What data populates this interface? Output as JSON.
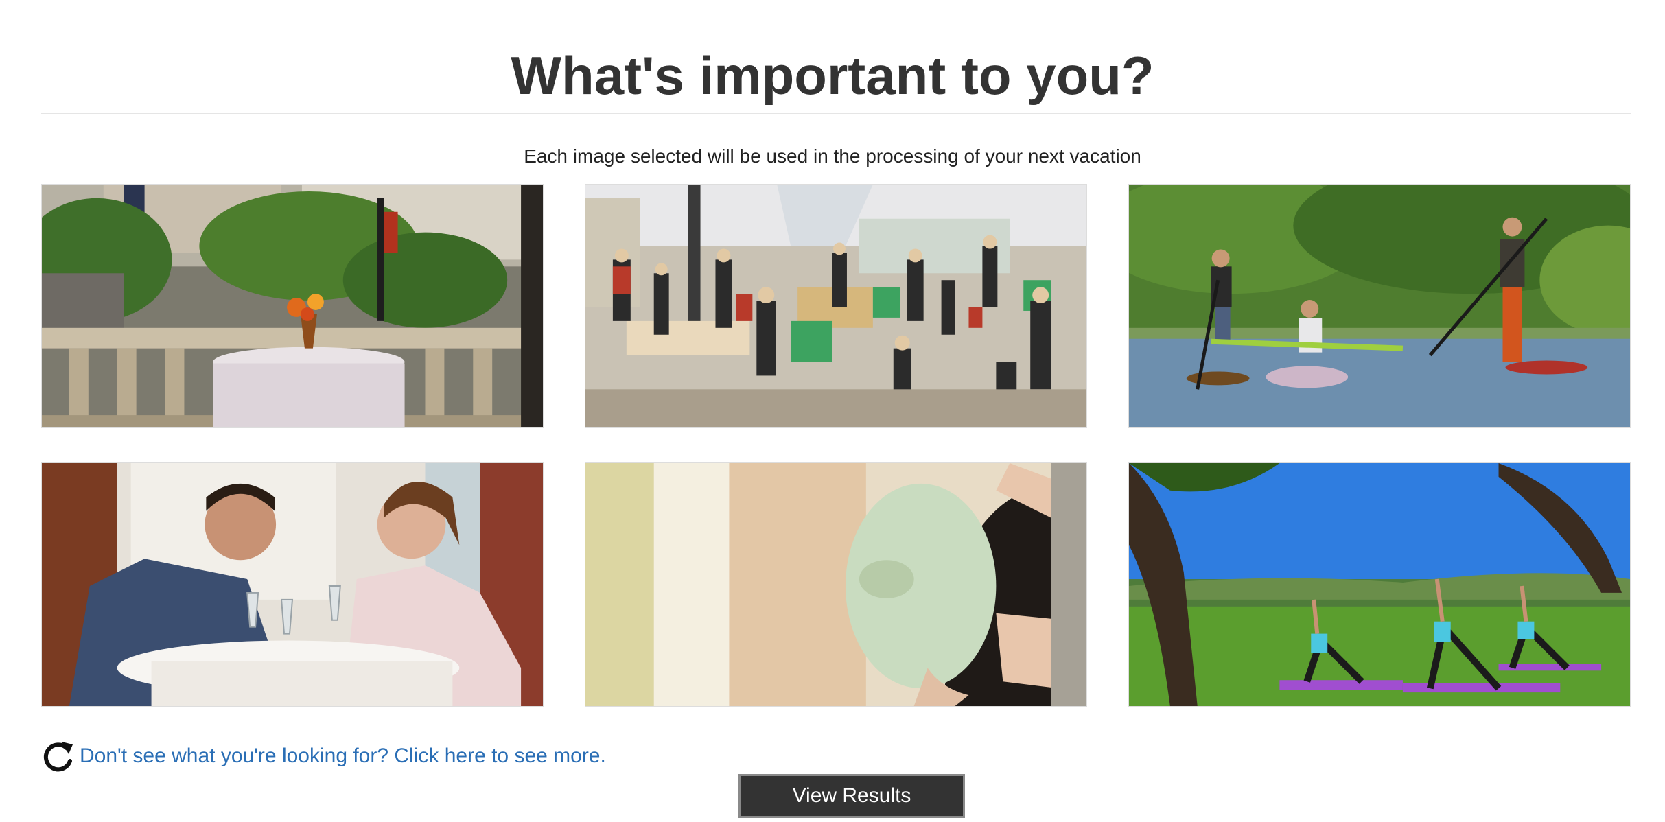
{
  "header": {
    "title": "What's important to you?",
    "subtitle": "Each image selected will be used in the processing of your next vacation"
  },
  "images": [
    {
      "name": "rooftop-dining-image",
      "icon": "photo-rooftop-table"
    },
    {
      "name": "childrens-museum-image",
      "icon": "photo-crowded-museum"
    },
    {
      "name": "paddleboard-kayak-image",
      "icon": "photo-paddle-river"
    },
    {
      "name": "romantic-dinner-image",
      "icon": "photo-couple-dinner"
    },
    {
      "name": "spa-facial-image",
      "icon": "photo-face-mask"
    },
    {
      "name": "outdoor-yoga-image",
      "icon": "photo-yoga-park"
    }
  ],
  "footer": {
    "more_icon": "refresh-icon",
    "more_link": "Don't see what you're looking for? Click here to see more.",
    "button_label": "View Results"
  },
  "colors": {
    "link": "#2a6eb5",
    "button_bg": "#333333",
    "button_text": "#ffffff"
  }
}
